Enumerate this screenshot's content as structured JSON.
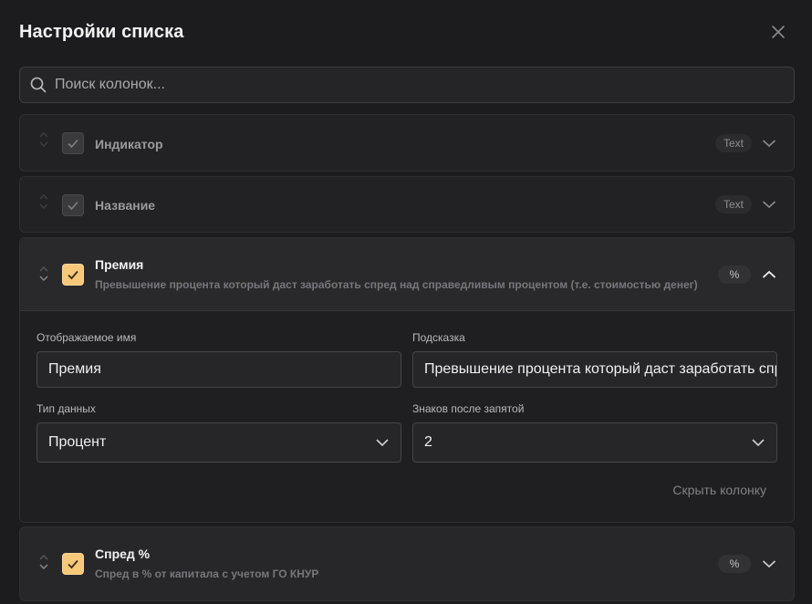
{
  "dialog": {
    "title": "Настройки списка"
  },
  "search": {
    "placeholder": "Поиск колонок..."
  },
  "columns": [
    {
      "name": "Индикатор",
      "badge": "Text"
    },
    {
      "name": "Название",
      "badge": "Text"
    },
    {
      "name": "Премия",
      "description": "Превышение процента который даст заработать спред над справедливым процентом (т.е. стоимостью денег)",
      "badge": "%"
    },
    {
      "name": "Спред %",
      "description": "Спред в % от капитала с учетом ГО КНУР",
      "badge": "%"
    }
  ],
  "editor": {
    "display_name_label": "Отображаемое имя",
    "display_name_value": "Премия",
    "hint_label": "Подсказка",
    "hint_value": "Превышение процента который даст заработать спред над справедливым процентом (т.е. стоимостью денег)",
    "data_type_label": "Тип данных",
    "data_type_value": "Процент",
    "decimals_label": "Знаков после запятой",
    "decimals_value": "2",
    "hide_label": "Скрыть колонку"
  },
  "colors": {
    "background": "#1c1c1e",
    "checkbox_active": "#f7c77a"
  }
}
